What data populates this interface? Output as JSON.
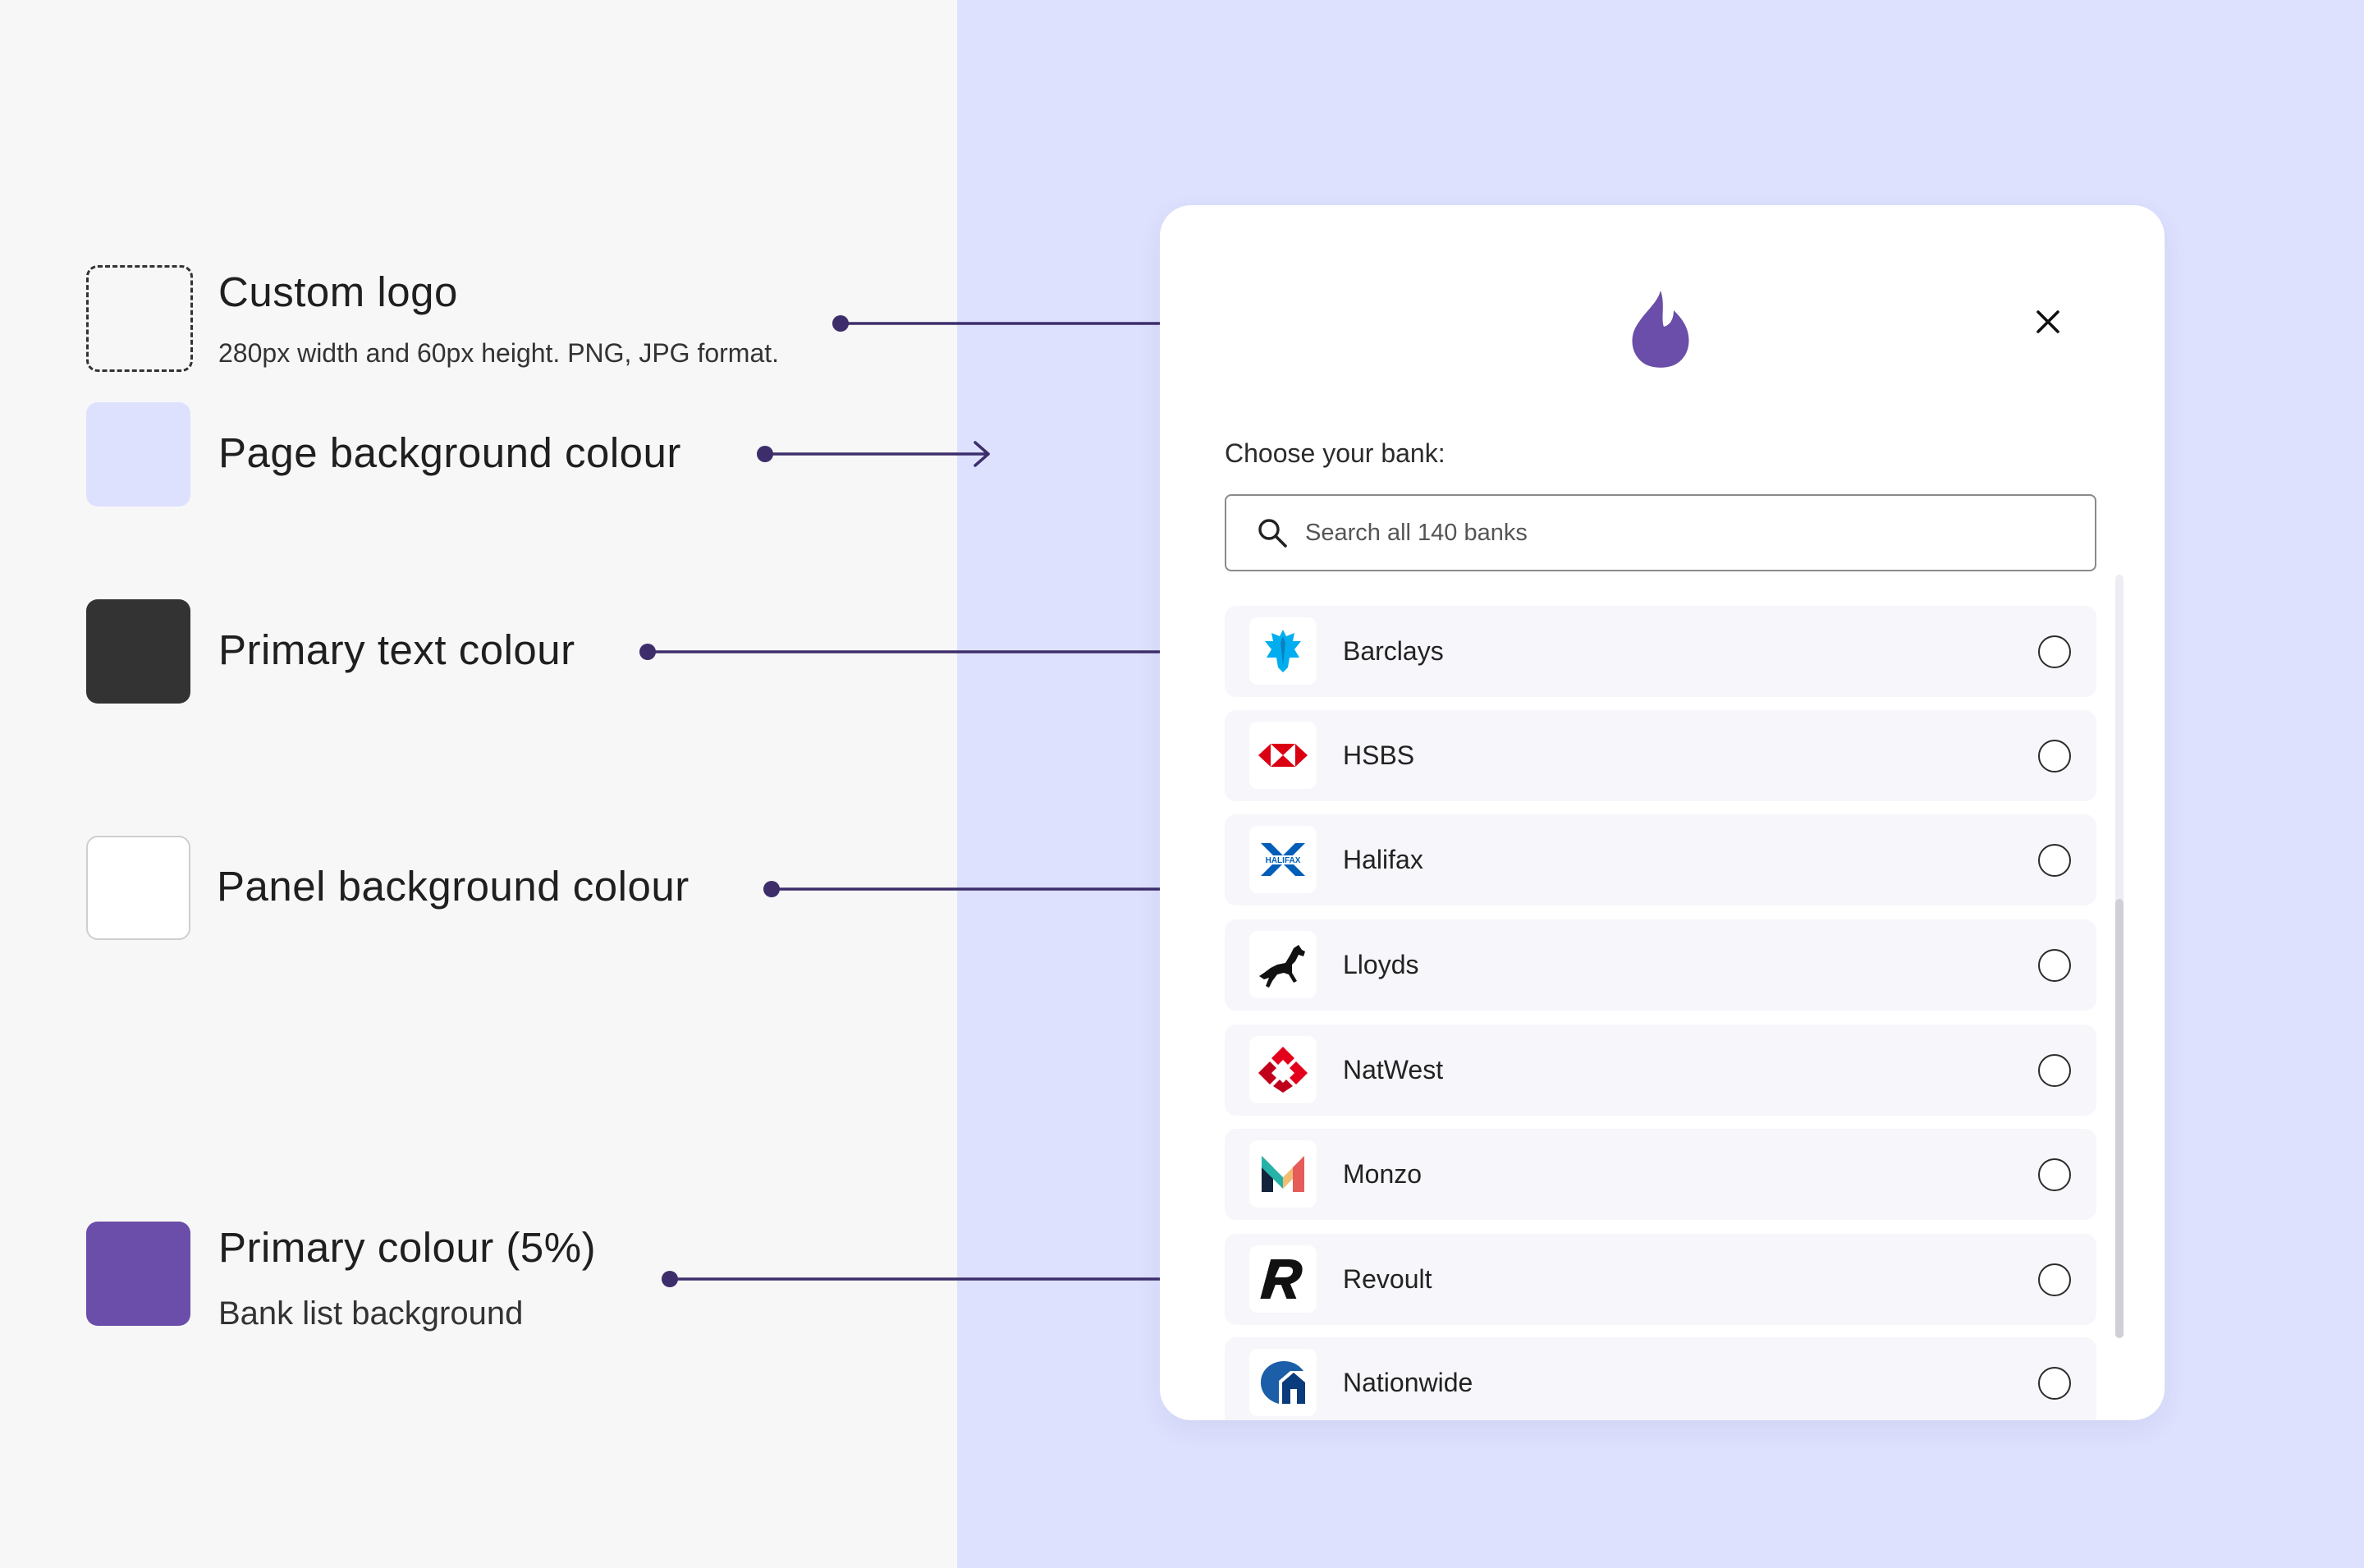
{
  "legend": {
    "custom_logo": {
      "title": "Custom logo",
      "subtitle": "280px width and 60px height. PNG, JPG format."
    },
    "page_background": {
      "title": "Page background colour",
      "color": "#dde1fe"
    },
    "primary_text": {
      "title": "Primary text colour",
      "color": "#333333"
    },
    "panel_background": {
      "title": "Panel background colour",
      "color": "#ffffff"
    },
    "primary_colour": {
      "title": "Primary colour (5%)",
      "subtitle": "Bank list background",
      "color": "#6a4ea9"
    }
  },
  "panel": {
    "logo_icon": "flame-logo-icon",
    "close_icon": "close-icon",
    "choose_label": "Choose your bank:",
    "search": {
      "placeholder": "Search all 140 banks",
      "value": ""
    },
    "banks": [
      {
        "name": "Barclays",
        "icon": "barclays-eagle-icon"
      },
      {
        "name": "HSBS",
        "icon": "hsbc-hexagon-icon"
      },
      {
        "name": "Halifax",
        "icon": "halifax-x-icon",
        "logo_text": "HALIFAX"
      },
      {
        "name": "Lloyds",
        "icon": "lloyds-horse-icon"
      },
      {
        "name": "NatWest",
        "icon": "natwest-cubes-icon"
      },
      {
        "name": "Monzo",
        "icon": "monzo-m-icon"
      },
      {
        "name": "Revoult",
        "icon": "revolut-r-icon"
      },
      {
        "name": "Nationwide",
        "icon": "nationwide-house-icon"
      }
    ]
  },
  "colors": {
    "accent": "#6a4ea9",
    "connector": "#3d2e6b"
  }
}
